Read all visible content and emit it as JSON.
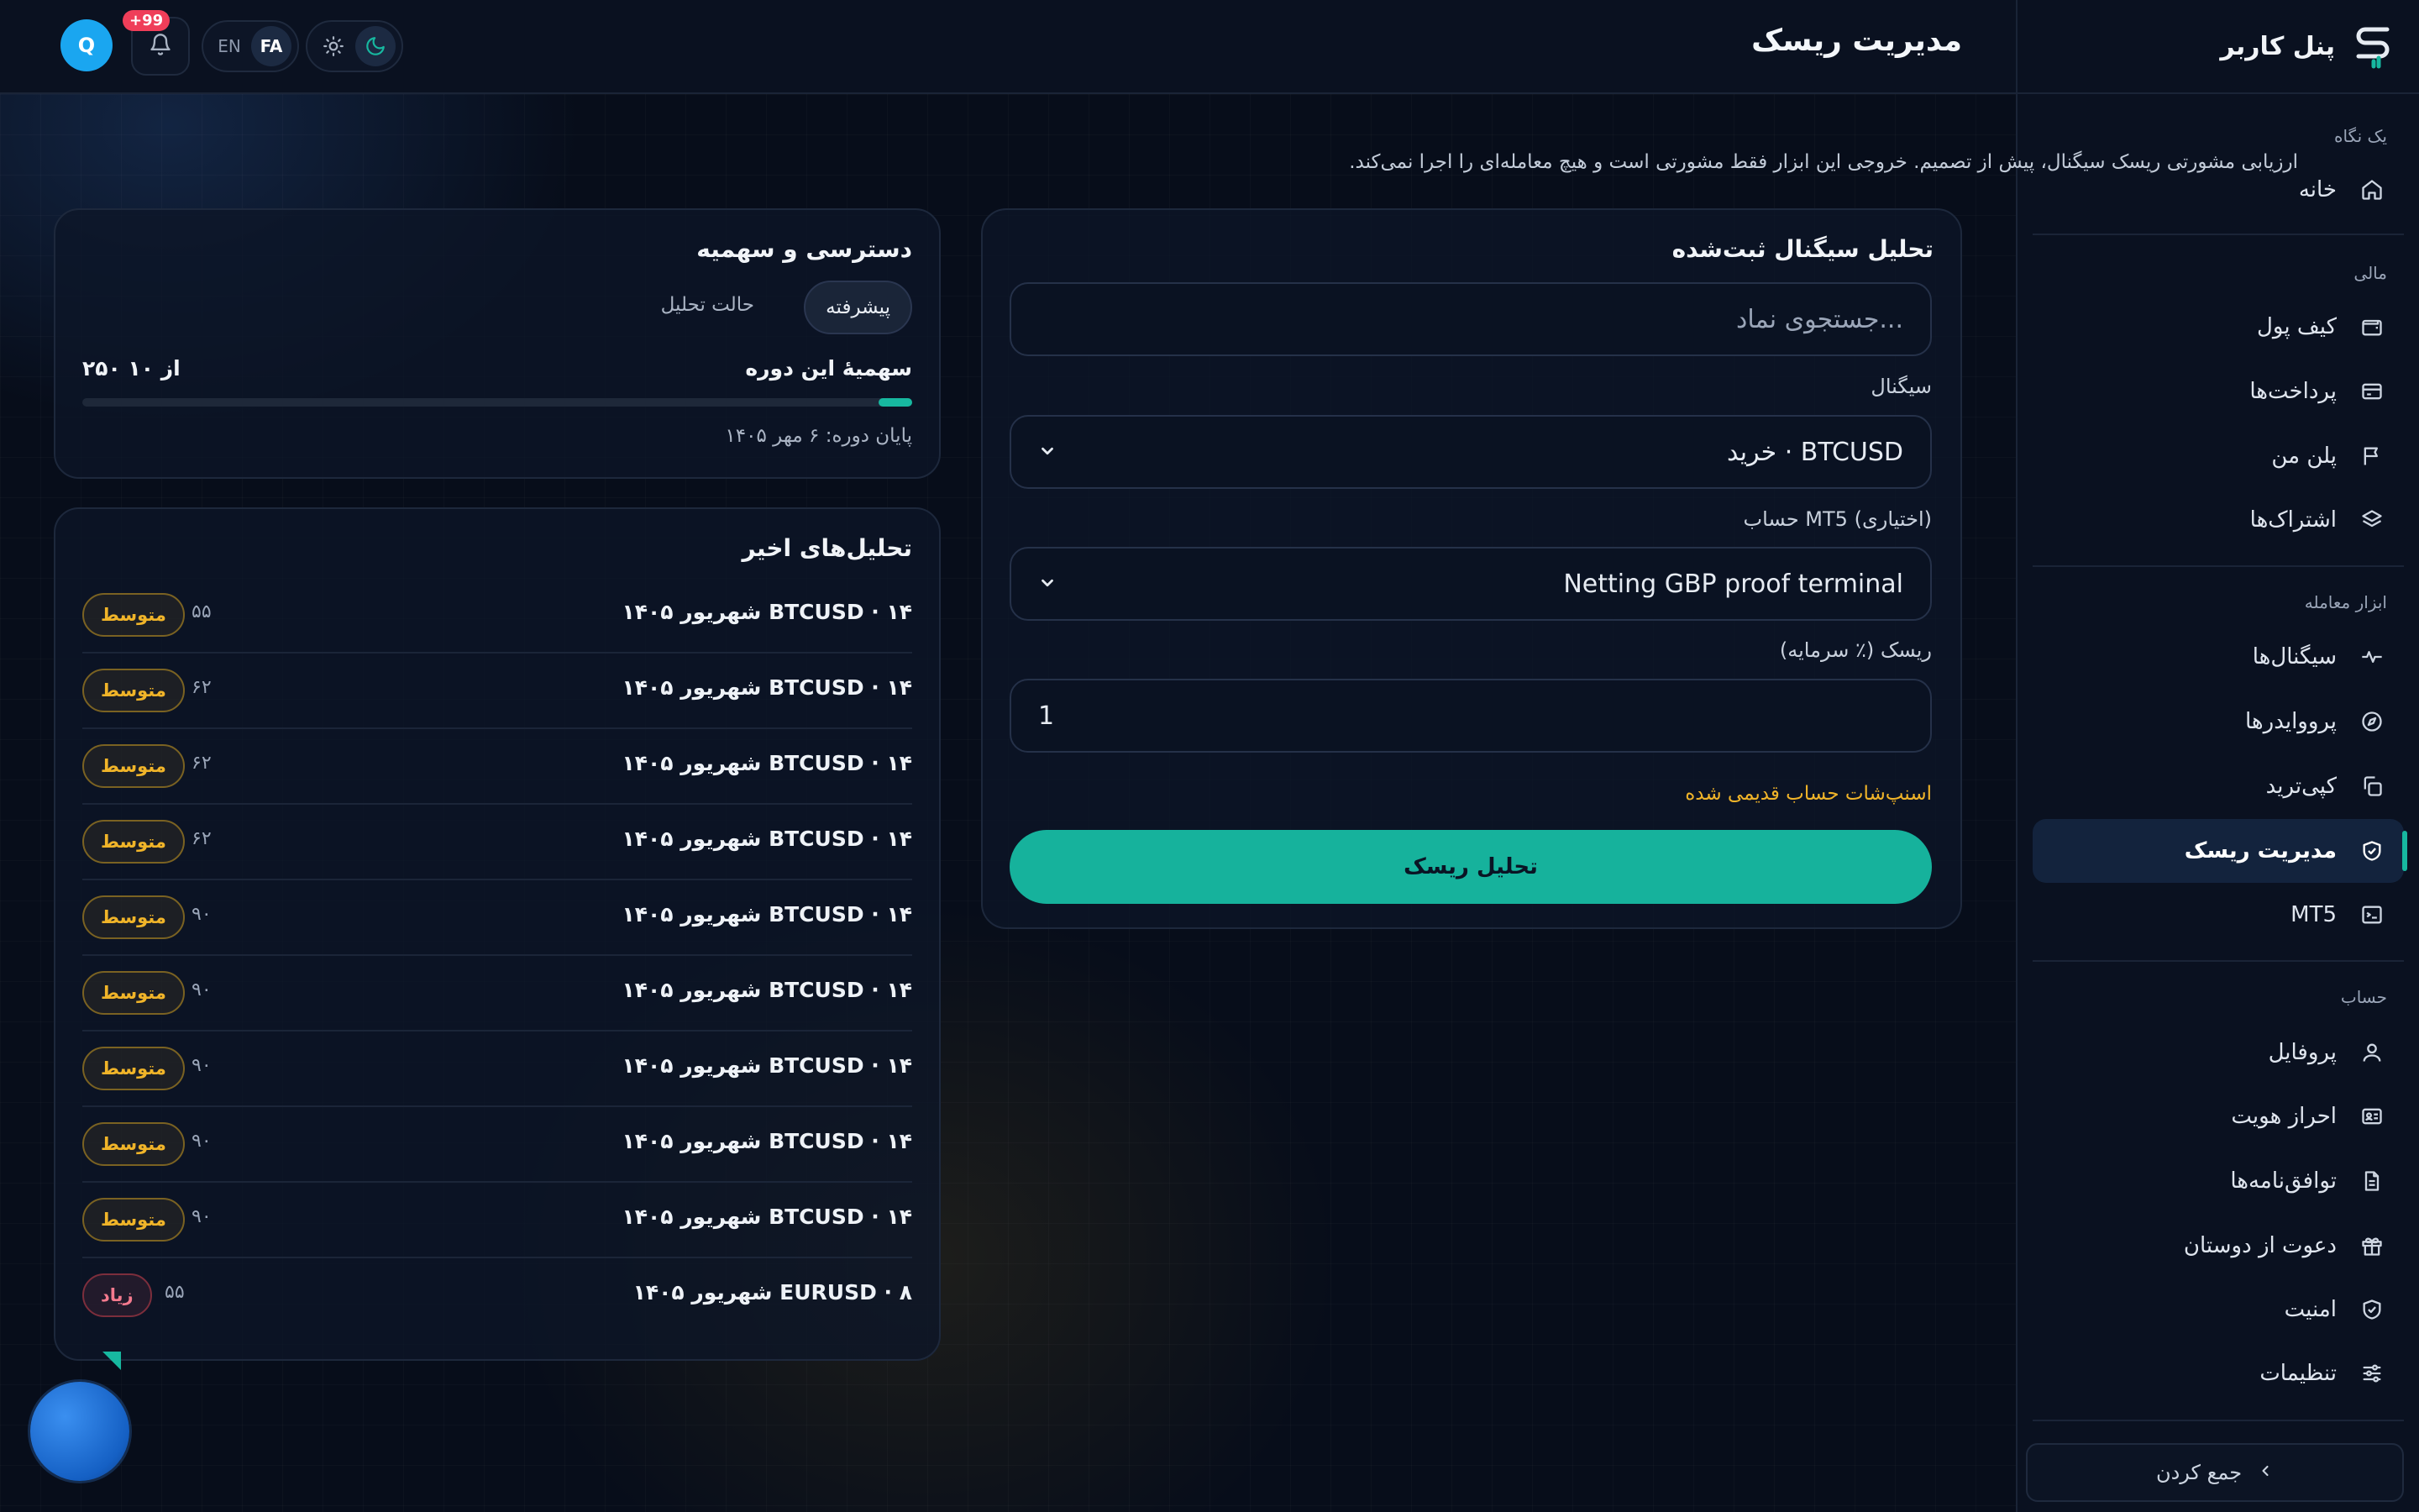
{
  "sidebar": {
    "title": "پنل کاربر",
    "sections": [
      {
        "label": "یک نگاه"
      },
      {
        "label": "مالی"
      },
      {
        "label": "ابزار معامله"
      },
      {
        "label": "حساب"
      }
    ],
    "items": [
      {
        "label": "خانه",
        "icon": "home-icon"
      },
      {
        "label": "کیف پول",
        "icon": "wallet-icon"
      },
      {
        "label": "پرداخت‌ها",
        "icon": "card-icon"
      },
      {
        "label": "پلن من",
        "icon": "flag-icon"
      },
      {
        "label": "اشتراک‌ها",
        "icon": "layers-icon"
      },
      {
        "label": "سیگنال‌ها",
        "icon": "pulse-icon"
      },
      {
        "label": "پرووایدرها",
        "icon": "compass-icon"
      },
      {
        "label": "کپی‌ترید",
        "icon": "copy-icon"
      },
      {
        "label": "مدیریت ریسک",
        "icon": "shield-check-icon",
        "active": true
      },
      {
        "label": "MT5",
        "icon": "terminal-icon"
      },
      {
        "label": "پروفایل",
        "icon": "user-icon"
      },
      {
        "label": "احراز هویت",
        "icon": "id-card-icon"
      },
      {
        "label": "توافق‌نامه‌ها",
        "icon": "document-icon"
      },
      {
        "label": "دعوت از دوستان",
        "icon": "gift-icon"
      },
      {
        "label": "امنیت",
        "icon": "shield-icon"
      },
      {
        "label": "تنظیمات",
        "icon": "sliders-icon"
      }
    ],
    "collapse_label": "جمع کردن"
  },
  "header": {
    "title": "مدیریت ریسک",
    "avatar_initial": "Q",
    "notifications_badge": "+99",
    "lang": {
      "fa": "FA",
      "en": "EN",
      "active": "FA"
    },
    "theme": {
      "active": "dark"
    }
  },
  "intro": "ارزیابی مشورتی ریسک سیگنال، پیش از تصمیم. خروجی این ابزار فقط مشورتی است و هیچ معامله‌ای را اجرا نمی‌کند.",
  "analysis": {
    "title": "تحلیل سیگنال ثبت‌شده",
    "search_placeholder": "...جستجوی نماد",
    "signal_label": "سیگنال",
    "signal_value": "BTCUSD · خرید",
    "account_label": "حساب MT5 (اختیاری)",
    "account_value": "Netting GBP proof terminal",
    "risk_label": "ریسک (٪ سرمایه)",
    "risk_value": "1",
    "warning": "اسنپ‌شات حساب قدیمی شده",
    "submit_label": "تحلیل ریسک"
  },
  "quota": {
    "title": "دسترسی و سهمیه",
    "mode_label": "حالت تحلیل",
    "mode_value": "پیشرفته",
    "period_label": "سهمیهٔ این دوره",
    "period_value": "از ۱۰ ۲۵۰",
    "used_fraction": 0.04,
    "period_end": "پایان دوره: ۶ مهر ۱۴۰۵"
  },
  "recent": {
    "title": "تحلیل‌های اخیر",
    "rows": [
      {
        "title": "BTCUSD · ۱۴ شهریور ۱۴۰۵",
        "score": "۵۵",
        "level": "متوسط",
        "kind": "mid"
      },
      {
        "title": "BTCUSD · ۱۴ شهریور ۱۴۰۵",
        "score": "۶۲",
        "level": "متوسط",
        "kind": "mid"
      },
      {
        "title": "BTCUSD · ۱۴ شهریور ۱۴۰۵",
        "score": "۶۲",
        "level": "متوسط",
        "kind": "mid"
      },
      {
        "title": "BTCUSD · ۱۴ شهریور ۱۴۰۵",
        "score": "۶۲",
        "level": "متوسط",
        "kind": "mid"
      },
      {
        "title": "BTCUSD · ۱۴ شهریور ۱۴۰۵",
        "score": "۹۰",
        "level": "متوسط",
        "kind": "mid"
      },
      {
        "title": "BTCUSD · ۱۴ شهریور ۱۴۰۵",
        "score": "۹۰",
        "level": "متوسط",
        "kind": "mid"
      },
      {
        "title": "BTCUSD · ۱۴ شهریور ۱۴۰۵",
        "score": "۹۰",
        "level": "متوسط",
        "kind": "mid"
      },
      {
        "title": "BTCUSD · ۱۴ شهریور ۱۴۰۵",
        "score": "۹۰",
        "level": "متوسط",
        "kind": "mid"
      },
      {
        "title": "BTCUSD · ۱۴ شهریور ۱۴۰۵",
        "score": "۹۰",
        "level": "متوسط",
        "kind": "mid"
      },
      {
        "title": "EURUSD · ۸ شهریور ۱۴۰۵",
        "score": "۵۵",
        "level": "زیاد",
        "kind": "high"
      }
    ]
  },
  "colors": {
    "accent": "#17b8a0",
    "warning": "#f0b429",
    "danger": "#f47a8e",
    "bg": "#070d1a"
  }
}
